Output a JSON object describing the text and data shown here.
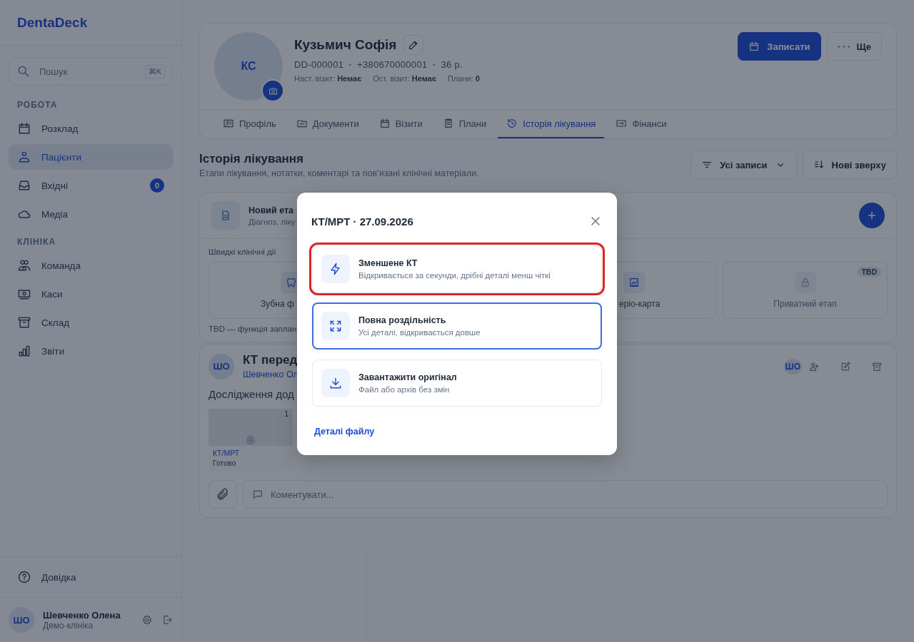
{
  "app": {
    "logo": "DentaDeck"
  },
  "sidebar": {
    "search": {
      "placeholder": "Пошук",
      "shortcut": "⌘K"
    },
    "sections": [
      {
        "title": "РОБОТА",
        "items": [
          {
            "label": "Розклад",
            "selected": false
          },
          {
            "label": "Пацієнти",
            "selected": true
          },
          {
            "label": "Вхідні",
            "selected": false,
            "badge": "0"
          },
          {
            "label": "Медіа",
            "selected": false
          }
        ]
      },
      {
        "title": "КЛІНІКА",
        "items": [
          {
            "label": "Команда",
            "selected": false
          },
          {
            "label": "Каси",
            "selected": false
          },
          {
            "label": "Склад",
            "selected": false
          },
          {
            "label": "Звіти",
            "selected": false
          }
        ]
      }
    ],
    "help": "Довідка",
    "user": {
      "initials": "ШО",
      "name": "Шевченко Олена",
      "org": "Демо-клініка"
    }
  },
  "patient": {
    "initials": "КС",
    "name": "Кузьмич Софія",
    "meta": [
      "DD-000001",
      "+380670000001",
      "36 р."
    ],
    "stats": [
      {
        "label": "Наст. візит:",
        "value": "Немає"
      },
      {
        "label": "Ост. візит:",
        "value": "Немає"
      },
      {
        "label": "Плани:",
        "value": "0"
      }
    ],
    "actions": [
      {
        "label": "Записати",
        "kind": "primary"
      },
      {
        "label": "Ще",
        "kind": "secondary"
      }
    ]
  },
  "tabs": [
    {
      "label": "Профіль",
      "selected": false
    },
    {
      "label": "Документи",
      "selected": false
    },
    {
      "label": "Візити",
      "selected": false
    },
    {
      "label": "Плани",
      "selected": false
    },
    {
      "label": "Історія лікування",
      "selected": true
    },
    {
      "label": "Фінанси",
      "selected": false
    }
  ],
  "history": {
    "title": "Історія лікування",
    "subtitle": "Етапи лікування, нотатки, коментарі та пов’язані клінічні матеріали.",
    "filter": "Усі записи",
    "sort": "Нові зверху"
  },
  "new_stage": {
    "title": "Новий ета",
    "subtitle": "Діагноз, ліку",
    "quick_title": "Швидкі клінічні дії",
    "actions": [
      {
        "label": "Зубна ф",
        "disabled": false
      },
      {
        "label": "еріо-карта",
        "disabled": false
      },
      {
        "label": "Приватний етап",
        "disabled": true,
        "badge": "TBD"
      }
    ],
    "note": "TBD — функція заплан"
  },
  "entry": {
    "initials": "ШО",
    "title": "КТ перед",
    "author": "Шевченко Ол",
    "assignee": "ШО",
    "text": "Дослідження дод",
    "attachments": [
      {
        "count": "1",
        "type": "КТ/МРТ",
        "status": "Готово"
      }
    ],
    "comment_placeholder": "Коментувати..."
  },
  "modal": {
    "title": "КТ/МРТ · 27.09.2026",
    "options": [
      {
        "title": "Зменшене КТ",
        "subtitle": "Відкривається за секунди, дрібні деталі менш чіткі",
        "highlighted": true,
        "focused": false
      },
      {
        "title": "Повна роздільність",
        "subtitle": "Усі деталі, відкривається довше",
        "highlighted": false,
        "focused": true
      },
      {
        "title": "Завантажити оригінал",
        "subtitle": "Файл або архів без змін",
        "highlighted": false,
        "focused": false
      }
    ],
    "link": "Деталі файлу"
  }
}
